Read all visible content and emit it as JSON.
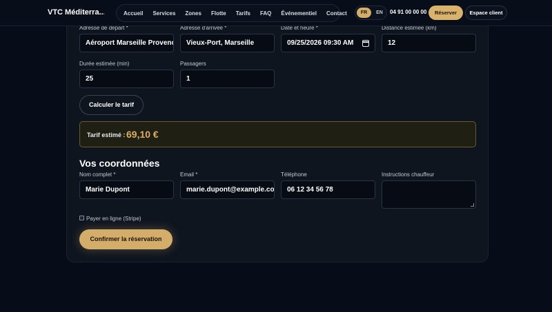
{
  "header": {
    "brand": "VTC Méditerra...",
    "nav": [
      "Accueil",
      "Services",
      "Zones",
      "Flotte",
      "Tarifs",
      "FAQ",
      "Événementiel",
      "Contact"
    ],
    "lang_fr": "FR",
    "lang_en": "EN",
    "phone": "04 91 00 00 00",
    "reserve_label": "Réserver",
    "client_label": "Espace client"
  },
  "trip": {
    "depart_label": "Adresse de départ *",
    "depart_value": "Aéroport Marseille Provence",
    "arrivee_label": "Adresse d'arrivée *",
    "arrivee_value": "Vieux-Port, Marseille",
    "datetime_label": "Date et heure *",
    "datetime_value": "09/25/2026 09:30 AM",
    "distance_label": "Distance estimée (km)",
    "distance_value": "12",
    "duree_label": "Durée estimée (min)",
    "duree_value": "25",
    "passagers_label": "Passagers",
    "passagers_value": "1",
    "calc_label": "Calculer le tarif"
  },
  "tarif": {
    "label": "Tarif estimé :",
    "value": "69,10 €"
  },
  "contact": {
    "title": "Vos coordonnées",
    "nom_label": "Nom complet *",
    "nom_value": "Marie Dupont",
    "email_label": "Email *",
    "email_value": "marie.dupont@example.com",
    "tel_label": "Téléphone",
    "tel_value": "06 12 34 56 78",
    "instructions_label": "Instructions chauffeur",
    "instructions_value": "",
    "stripe_label": "Payer en ligne (Stripe)",
    "confirm_label": "Confirmer la réservation"
  },
  "colors": {
    "accent": "#d9b36e",
    "price": "#dcae66",
    "background": "#070d18",
    "card": "#0f151f"
  }
}
